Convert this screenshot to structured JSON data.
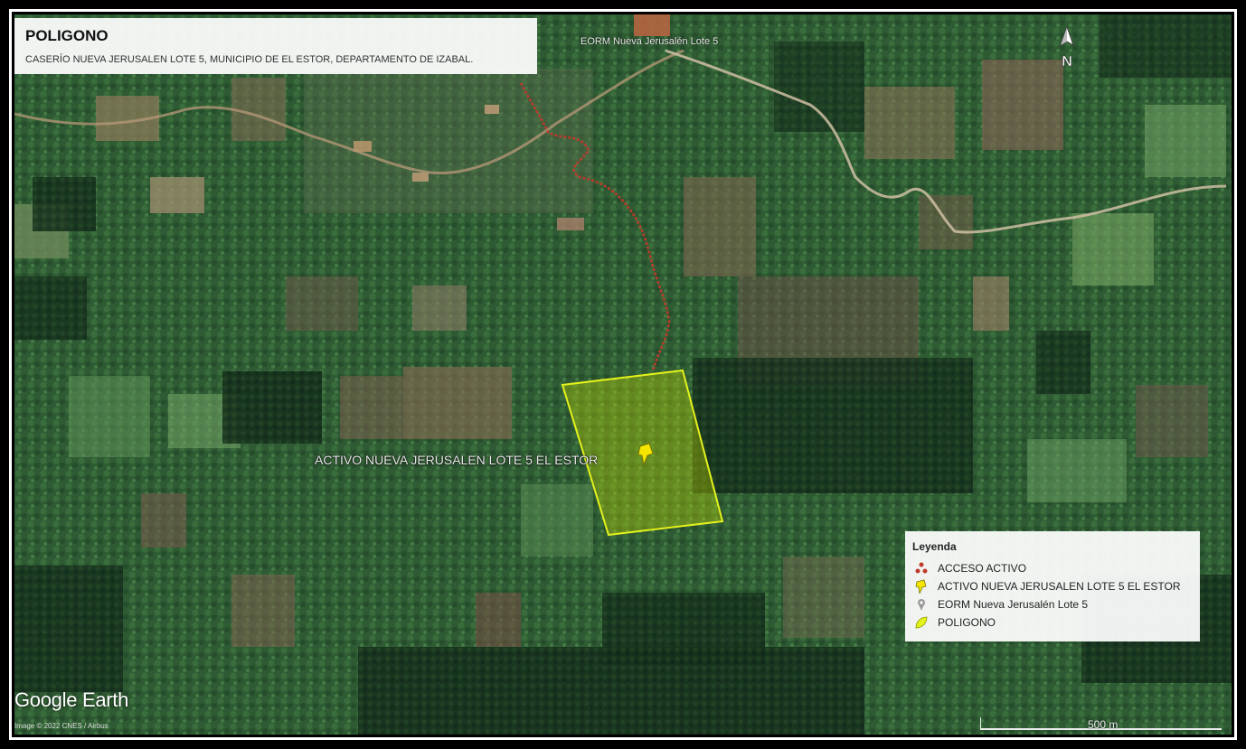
{
  "title": {
    "heading": "POLIGONO",
    "subtitle": "CASERÍO NUEVA JERUSALEN LOTE 5, MUNICIPIO DE EL ESTOR, DEPARTAMENTO DE IZABAL."
  },
  "map_labels": {
    "school": "EORM Nueva Jerusalén Lote 5",
    "asset": "ACTIVO NUEVA JERUSALEN LOTE 5 EL ESTOR"
  },
  "north_arrow": {
    "letter": "N",
    "icon": "north-arrow-icon"
  },
  "legend": {
    "title": "Leyenda",
    "items": [
      {
        "label": "ACCESO ACTIVO",
        "icon": "access-dots-icon",
        "color": "#c0392b"
      },
      {
        "label": "ACTIVO NUEVA JERUSALEN LOTE 5 EL ESTOR",
        "icon": "yellow-pin-icon",
        "color": "#f5e600"
      },
      {
        "label": "EORM Nueva Jerusalén Lote 5",
        "icon": "grey-pin-icon",
        "color": "#9a9a9a"
      },
      {
        "label": "POLIGONO",
        "icon": "polygon-leaf-icon",
        "color": "#d4ec1a"
      }
    ]
  },
  "branding": {
    "logo": "Google Earth",
    "copyright": "Image © 2022 CNES / Airbus"
  },
  "scale": {
    "label": "500 m"
  },
  "colors": {
    "access_route": "#c0392b",
    "polygon_stroke": "#e4f21c",
    "polygon_fill": "#c8e000",
    "pin": "#f5e600"
  }
}
